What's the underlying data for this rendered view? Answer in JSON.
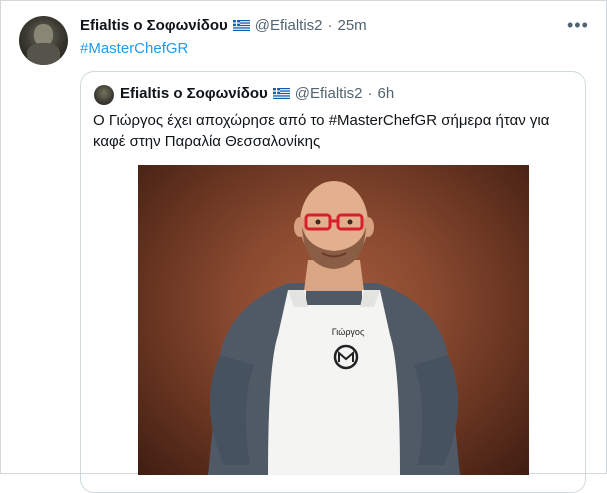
{
  "tweet": {
    "author_name": "Efialtis ο Σοφωνίδου",
    "handle": "@Efialtis2",
    "separator": "·",
    "time": "25m",
    "more_label": "•••",
    "hashtag": "#MasterChefGR"
  },
  "quoted": {
    "author_name": "Efialtis ο Σοφωνίδου",
    "handle": "@Efialtis2",
    "separator": "·",
    "time": "6h",
    "text_before": "Ο Γιώργος έχει αποχώρησε από το ",
    "text_hashtag": "#MasterChefGR",
    "text_after": " σήμερα ήταν για καφέ στην Παραλία Θεσσαλονίκης",
    "photo_apron_name": "Γιώργος"
  },
  "icons": {
    "flag": "greek-flag-icon",
    "more": "more-icon"
  },
  "colors": {
    "link": "#1d9bf0",
    "secondary_text": "#536471",
    "border": "#cfd9de",
    "photo_background": "#8a4a30"
  }
}
